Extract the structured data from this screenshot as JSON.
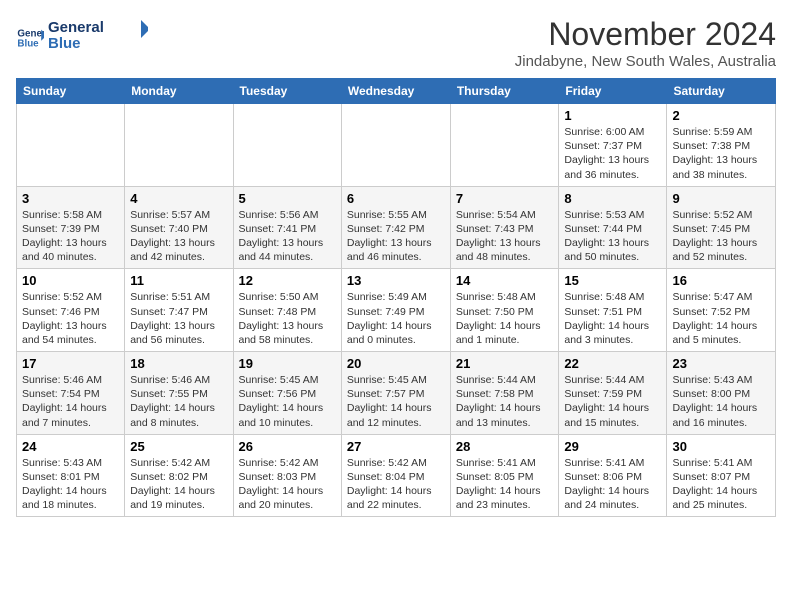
{
  "logo": {
    "line1": "General",
    "line2": "Blue"
  },
  "title": "November 2024",
  "location": "Jindabyne, New South Wales, Australia",
  "weekdays": [
    "Sunday",
    "Monday",
    "Tuesday",
    "Wednesday",
    "Thursday",
    "Friday",
    "Saturday"
  ],
  "weeks": [
    [
      {
        "day": "",
        "detail": ""
      },
      {
        "day": "",
        "detail": ""
      },
      {
        "day": "",
        "detail": ""
      },
      {
        "day": "",
        "detail": ""
      },
      {
        "day": "",
        "detail": ""
      },
      {
        "day": "1",
        "detail": "Sunrise: 6:00 AM\nSunset: 7:37 PM\nDaylight: 13 hours\nand 36 minutes."
      },
      {
        "day": "2",
        "detail": "Sunrise: 5:59 AM\nSunset: 7:38 PM\nDaylight: 13 hours\nand 38 minutes."
      }
    ],
    [
      {
        "day": "3",
        "detail": "Sunrise: 5:58 AM\nSunset: 7:39 PM\nDaylight: 13 hours\nand 40 minutes."
      },
      {
        "day": "4",
        "detail": "Sunrise: 5:57 AM\nSunset: 7:40 PM\nDaylight: 13 hours\nand 42 minutes."
      },
      {
        "day": "5",
        "detail": "Sunrise: 5:56 AM\nSunset: 7:41 PM\nDaylight: 13 hours\nand 44 minutes."
      },
      {
        "day": "6",
        "detail": "Sunrise: 5:55 AM\nSunset: 7:42 PM\nDaylight: 13 hours\nand 46 minutes."
      },
      {
        "day": "7",
        "detail": "Sunrise: 5:54 AM\nSunset: 7:43 PM\nDaylight: 13 hours\nand 48 minutes."
      },
      {
        "day": "8",
        "detail": "Sunrise: 5:53 AM\nSunset: 7:44 PM\nDaylight: 13 hours\nand 50 minutes."
      },
      {
        "day": "9",
        "detail": "Sunrise: 5:52 AM\nSunset: 7:45 PM\nDaylight: 13 hours\nand 52 minutes."
      }
    ],
    [
      {
        "day": "10",
        "detail": "Sunrise: 5:52 AM\nSunset: 7:46 PM\nDaylight: 13 hours\nand 54 minutes."
      },
      {
        "day": "11",
        "detail": "Sunrise: 5:51 AM\nSunset: 7:47 PM\nDaylight: 13 hours\nand 56 minutes."
      },
      {
        "day": "12",
        "detail": "Sunrise: 5:50 AM\nSunset: 7:48 PM\nDaylight: 13 hours\nand 58 minutes."
      },
      {
        "day": "13",
        "detail": "Sunrise: 5:49 AM\nSunset: 7:49 PM\nDaylight: 14 hours\nand 0 minutes."
      },
      {
        "day": "14",
        "detail": "Sunrise: 5:48 AM\nSunset: 7:50 PM\nDaylight: 14 hours\nand 1 minute."
      },
      {
        "day": "15",
        "detail": "Sunrise: 5:48 AM\nSunset: 7:51 PM\nDaylight: 14 hours\nand 3 minutes."
      },
      {
        "day": "16",
        "detail": "Sunrise: 5:47 AM\nSunset: 7:52 PM\nDaylight: 14 hours\nand 5 minutes."
      }
    ],
    [
      {
        "day": "17",
        "detail": "Sunrise: 5:46 AM\nSunset: 7:54 PM\nDaylight: 14 hours\nand 7 minutes."
      },
      {
        "day": "18",
        "detail": "Sunrise: 5:46 AM\nSunset: 7:55 PM\nDaylight: 14 hours\nand 8 minutes."
      },
      {
        "day": "19",
        "detail": "Sunrise: 5:45 AM\nSunset: 7:56 PM\nDaylight: 14 hours\nand 10 minutes."
      },
      {
        "day": "20",
        "detail": "Sunrise: 5:45 AM\nSunset: 7:57 PM\nDaylight: 14 hours\nand 12 minutes."
      },
      {
        "day": "21",
        "detail": "Sunrise: 5:44 AM\nSunset: 7:58 PM\nDaylight: 14 hours\nand 13 minutes."
      },
      {
        "day": "22",
        "detail": "Sunrise: 5:44 AM\nSunset: 7:59 PM\nDaylight: 14 hours\nand 15 minutes."
      },
      {
        "day": "23",
        "detail": "Sunrise: 5:43 AM\nSunset: 8:00 PM\nDaylight: 14 hours\nand 16 minutes."
      }
    ],
    [
      {
        "day": "24",
        "detail": "Sunrise: 5:43 AM\nSunset: 8:01 PM\nDaylight: 14 hours\nand 18 minutes."
      },
      {
        "day": "25",
        "detail": "Sunrise: 5:42 AM\nSunset: 8:02 PM\nDaylight: 14 hours\nand 19 minutes."
      },
      {
        "day": "26",
        "detail": "Sunrise: 5:42 AM\nSunset: 8:03 PM\nDaylight: 14 hours\nand 20 minutes."
      },
      {
        "day": "27",
        "detail": "Sunrise: 5:42 AM\nSunset: 8:04 PM\nDaylight: 14 hours\nand 22 minutes."
      },
      {
        "day": "28",
        "detail": "Sunrise: 5:41 AM\nSunset: 8:05 PM\nDaylight: 14 hours\nand 23 minutes."
      },
      {
        "day": "29",
        "detail": "Sunrise: 5:41 AM\nSunset: 8:06 PM\nDaylight: 14 hours\nand 24 minutes."
      },
      {
        "day": "30",
        "detail": "Sunrise: 5:41 AM\nSunset: 8:07 PM\nDaylight: 14 hours\nand 25 minutes."
      }
    ]
  ]
}
